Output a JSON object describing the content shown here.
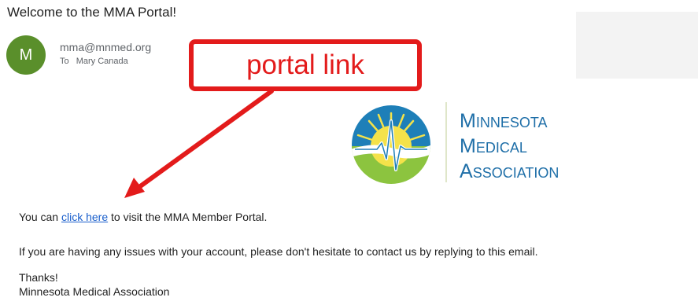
{
  "email": {
    "subject": "Welcome to the MMA Portal!",
    "avatar_letter": "M",
    "sender": "mma@mnmed.org",
    "to_label": "To",
    "recipient": "Mary Canada"
  },
  "annotation": {
    "callout_text": "portal link",
    "color": "#e31b1b"
  },
  "logo": {
    "line1_cap": "M",
    "line1_rest": "INNESOTA",
    "line2_cap": "M",
    "line2_rest": "EDICAL",
    "line3_cap": "A",
    "line3_rest": "SSOCIATION",
    "text_color": "#1f6fa8"
  },
  "body": {
    "line1_prefix": "You can ",
    "link_text": "click here",
    "line1_suffix": " to visit the MMA Member Portal.",
    "line2": "If you are having any issues with your account, please don't hesitate to contact us by replying to this email.",
    "thanks": "Thanks!",
    "signature": "Minnesota Medical Association"
  },
  "icons": [
    "avatar",
    "mma-logo-mark",
    "red-arrow"
  ]
}
